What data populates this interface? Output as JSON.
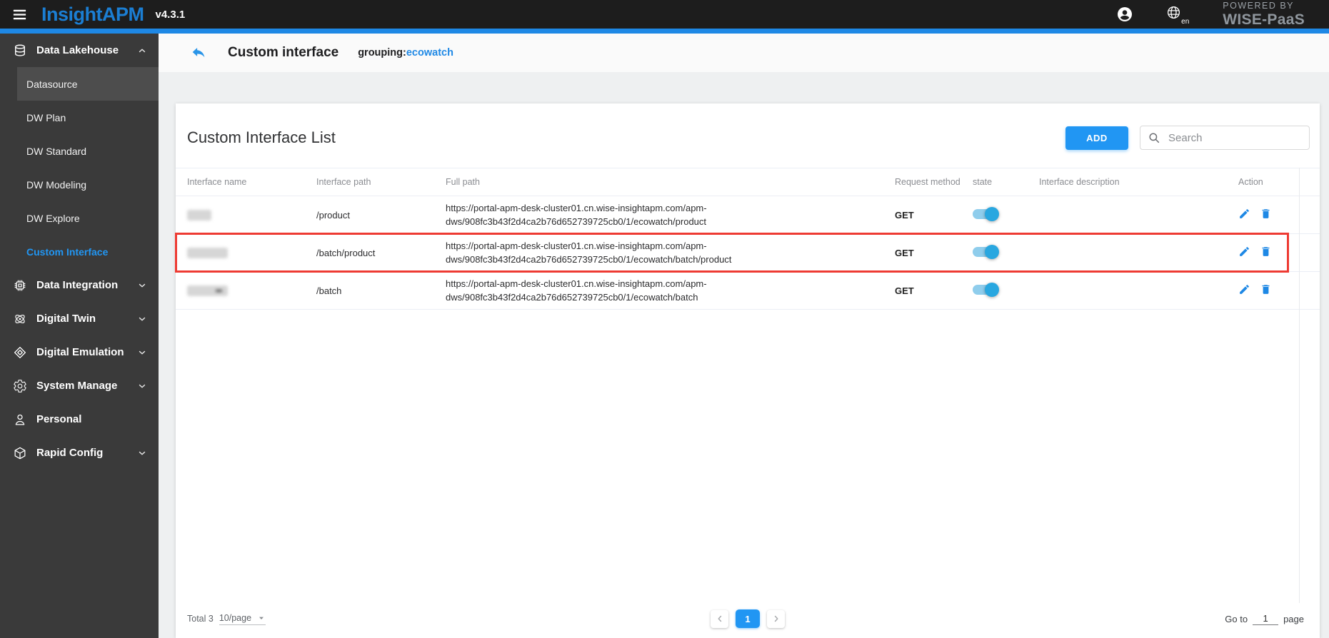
{
  "app": {
    "name": "InsightAPM",
    "version": "v4.3.1",
    "language": "en",
    "powered_by": "POWERED BY",
    "powered_brand": "WISE-PaaS"
  },
  "sidebar": {
    "items": [
      {
        "label": "Data Lakehouse",
        "icon": "database",
        "type": "section",
        "chevron": "up"
      },
      {
        "label": "Datasource",
        "type": "sub",
        "state": "hover"
      },
      {
        "label": "DW Plan",
        "type": "sub",
        "state": null
      },
      {
        "label": "DW Standard",
        "type": "sub",
        "state": null
      },
      {
        "label": "DW Modeling",
        "type": "sub",
        "state": null
      },
      {
        "label": "DW Explore",
        "type": "sub",
        "state": null
      },
      {
        "label": "Custom Interface",
        "type": "sub",
        "state": "selected"
      },
      {
        "label": "Data Integration",
        "icon": "chip",
        "type": "section",
        "chevron": "down"
      },
      {
        "label": "Digital Twin",
        "icon": "atom",
        "type": "section",
        "chevron": "down"
      },
      {
        "label": "Digital Emulation",
        "icon": "diamond",
        "type": "section",
        "chevron": "down"
      },
      {
        "label": "System Manage",
        "icon": "gear",
        "type": "section",
        "chevron": "down"
      },
      {
        "label": "Personal",
        "icon": "person",
        "type": "section",
        "chevron": null
      },
      {
        "label": "Rapid Config",
        "icon": "cube",
        "type": "section",
        "chevron": "down"
      }
    ]
  },
  "breadcrumb": {
    "title": "Custom interface",
    "grouping_label": "grouping:",
    "grouping_value": "ecowatch"
  },
  "panel": {
    "title": "Custom Interface List",
    "add_button": "ADD",
    "search_placeholder": "Search",
    "search_value": ""
  },
  "table": {
    "columns": [
      "Interface name",
      "Interface path",
      "Full path",
      "Request method",
      "state",
      "Interface description",
      "Action"
    ],
    "rows": [
      {
        "name_redacted": true,
        "redaction_width": 34,
        "redaction_mark": false,
        "interface_path": "/product",
        "full_path": "https://portal-apm-desk-cluster01.cn.wise-insightapm.com/apm-dws/908fc3b43f2d4ca2b76d652739725cb0/1/ecowatch/product",
        "request_method": "GET",
        "state": "on",
        "interface_description": "",
        "highlighted": false
      },
      {
        "name_redacted": true,
        "redaction_width": 57,
        "redaction_mark": false,
        "interface_path": "/batch/product",
        "full_path": "https://portal-apm-desk-cluster01.cn.wise-insightapm.com/apm-dws/908fc3b43f2d4ca2b76d652739725cb0/1/ecowatch/batch/product",
        "request_method": "GET",
        "state": "on",
        "interface_description": "",
        "highlighted": true
      },
      {
        "name_redacted": true,
        "redaction_width": 57,
        "redaction_mark": true,
        "interface_path": "/batch",
        "full_path": "https://portal-apm-desk-cluster01.cn.wise-insightapm.com/apm-dws/908fc3b43f2d4ca2b76d652739725cb0/1/ecowatch/batch",
        "request_method": "GET",
        "state": "on",
        "interface_description": "",
        "highlighted": false
      }
    ]
  },
  "pagination": {
    "total": "Total 3",
    "page_size": "10/page",
    "pages": [
      "1"
    ],
    "active_page": "1",
    "goto_label": "Go to",
    "goto_value": "1",
    "goto_suffix": "page"
  },
  "colors": {
    "accent": "#2196f3",
    "header_strip": "#1e88e5",
    "logo_blue": "#1b7ed3",
    "highlight_red": "#ee3b33",
    "toggle_on": "#29a7e0",
    "action_icon": "#1e88e5"
  }
}
